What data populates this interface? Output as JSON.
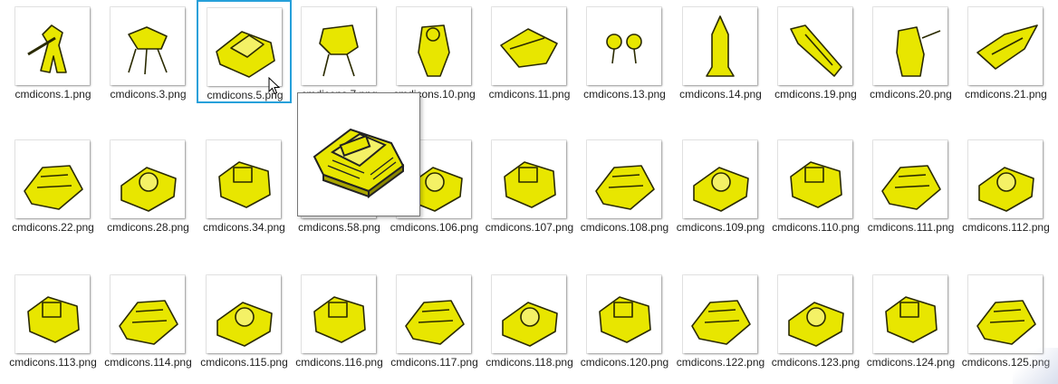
{
  "window": {
    "background": "#ffffff",
    "selection_color": "#26a0da",
    "icon_color": "#e8e600"
  },
  "files": [
    {
      "name": "cmdicons.1.png",
      "icon": "marine-unit-icon"
    },
    {
      "name": "cmdicons.3.png",
      "icon": "goliath-walker-icon"
    },
    {
      "name": "cmdicons.5.png",
      "icon": "siege-tank-icon",
      "selected": true
    },
    {
      "name": "cmdicons.7.png",
      "icon": "mech-walker-icon"
    },
    {
      "name": "cmdicons.10.png",
      "icon": "firebat-unit-icon"
    },
    {
      "name": "cmdicons.11.png",
      "icon": "vulture-bike-icon"
    },
    {
      "name": "cmdicons.13.png",
      "icon": "spider-mine-icon"
    },
    {
      "name": "cmdicons.14.png",
      "icon": "nuke-missile-icon"
    },
    {
      "name": "cmdicons.19.png",
      "icon": "wraith-fighter-icon"
    },
    {
      "name": "cmdicons.20.png",
      "icon": "ghost-unit-icon"
    },
    {
      "name": "cmdicons.21.png",
      "icon": "valkyrie-ship-icon"
    },
    {
      "name": "cmdicons.22.png",
      "icon": "dropship-icon"
    },
    {
      "name": "cmdicons.28.png",
      "icon": "science-vessel-icon"
    },
    {
      "name": "cmdicons.34.png",
      "icon": "hero-marine-icon"
    },
    {
      "name": "cmdicons.58.png",
      "icon": "hero-tank-icon"
    },
    {
      "name": "cmdicons.106.png",
      "icon": "command-center-icon"
    },
    {
      "name": "cmdicons.107.png",
      "icon": "comsat-station-icon"
    },
    {
      "name": "cmdicons.108.png",
      "icon": "nuclear-silo-icon"
    },
    {
      "name": "cmdicons.109.png",
      "icon": "supply-depot-icon"
    },
    {
      "name": "cmdicons.110.png",
      "icon": "refinery-icon"
    },
    {
      "name": "cmdicons.111.png",
      "icon": "barracks-icon"
    },
    {
      "name": "cmdicons.112.png",
      "icon": "academy-icon"
    },
    {
      "name": "cmdicons.113.png",
      "icon": "factory-icon"
    },
    {
      "name": "cmdicons.114.png",
      "icon": "starport-icon"
    },
    {
      "name": "cmdicons.115.png",
      "icon": "control-tower-icon"
    },
    {
      "name": "cmdicons.116.png",
      "icon": "science-facility-icon"
    },
    {
      "name": "cmdicons.117.png",
      "icon": "covert-ops-icon"
    },
    {
      "name": "cmdicons.118.png",
      "icon": "physics-lab-icon"
    },
    {
      "name": "cmdicons.120.png",
      "icon": "machine-shop-icon"
    },
    {
      "name": "cmdicons.122.png",
      "icon": "engineering-bay-icon"
    },
    {
      "name": "cmdicons.123.png",
      "icon": "armory-icon"
    },
    {
      "name": "cmdicons.124.png",
      "icon": "missile-turret-icon"
    },
    {
      "name": "cmdicons.125.png",
      "icon": "bunker-icon"
    }
  ],
  "preview": {
    "icon": "siege-tank-preview-icon"
  },
  "cursor": {
    "icon": "mouse-pointer-icon"
  }
}
